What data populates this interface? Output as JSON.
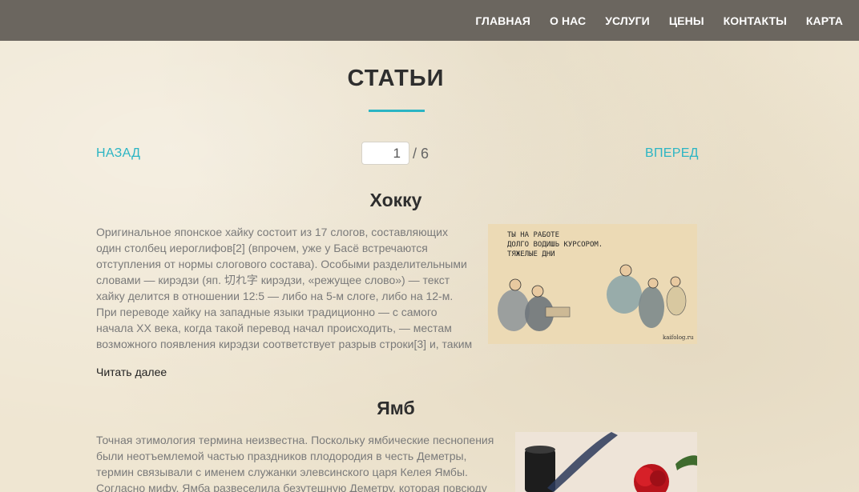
{
  "nav": {
    "items": [
      "ГЛАВНАЯ",
      "О НАС",
      "УСЛУГИ",
      "ЦЕНЫ",
      "КОНТАКТЫ",
      "КАРТА"
    ]
  },
  "page": {
    "title": "СТАТЬИ"
  },
  "pager": {
    "prev_label": "НАЗАД",
    "next_label": "ВПЕРЕД",
    "current_page": "1",
    "total": "/ 6"
  },
  "articles": [
    {
      "title": "Хокку",
      "text": "Оригинальное японское хайку состоит из 17 слогов, составляющих один столбец иероглифов[2] (впрочем, уже у Басё встречаются отступления от нормы слогового состава). Особыми разделительными словами — кирэдзи (яп. 切れ字 кирэдзи, «режущее слово») — текст хайку делится в отношении 12:5 — либо на 5-м слоге, либо на 12-м. При переводе хайку на западные языки традиционно — с самого начала XX века, когда такой перевод начал происходить, — местам возможного появления кирэдзи соответствует разрыв строки[3] и, таким образом, хайку записываются",
      "read_more": "Читать далее",
      "image": {
        "caption_lines": [
          "ТЫ НА РАБОТЕ",
          "ДОЛГО ВОДИШЬ КУРСОРОМ.",
          "ТЯЖЕЛЫЕ ДНИ"
        ],
        "watermark": "kaifolog.ru"
      }
    },
    {
      "title": "Ямб",
      "text": "Точная этимология термина неизвестна. Поскольку ямбические песнопения были неотъемлемой частью праздников плодородия в честь Деметры, термин связывали с именем служанки элевсинского царя Келея Ямбы. Согласно мифу, Ямба развеселила безутешную Деметру, которая повсюду искала дочь"
    }
  ]
}
